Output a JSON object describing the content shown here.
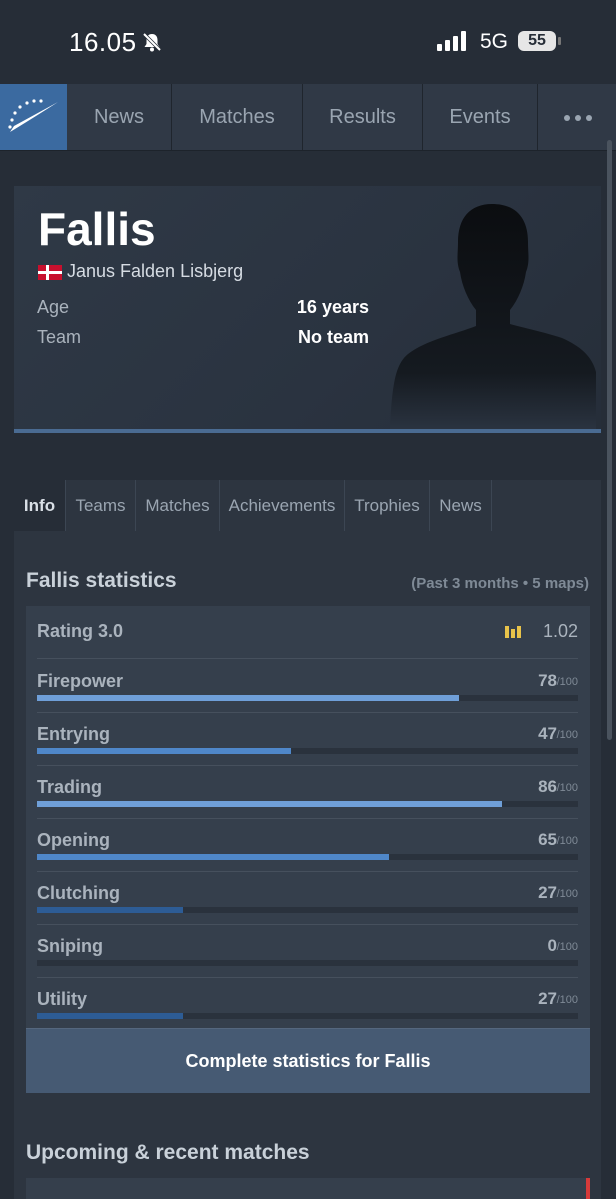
{
  "status_bar": {
    "time": "16.05",
    "network": "5G",
    "battery": "55"
  },
  "nav": {
    "items": [
      "News",
      "Matches",
      "Results",
      "Events"
    ]
  },
  "profile": {
    "nickname": "Fallis",
    "real_name": "Janus Falden Lisbjerg",
    "country_flag": "denmark-flag",
    "age_label": "Age",
    "age_value": "16 years",
    "team_label": "Team",
    "team_value": "No team"
  },
  "tabs": [
    "Info",
    "Teams",
    "Matches",
    "Achievements",
    "Trophies",
    "News"
  ],
  "statistics": {
    "title": "Fallis statistics",
    "subtitle": "(Past 3 months • 5 maps)",
    "rating_label": "Rating 3.0",
    "rating_value": "1.02",
    "max_suffix": "/100",
    "rows": [
      {
        "label": "Firepower",
        "value": "78",
        "percent": 78,
        "color": "#6f9fd8"
      },
      {
        "label": "Entrying",
        "value": "47",
        "percent": 47,
        "color": "#4f87c9"
      },
      {
        "label": "Trading",
        "value": "86",
        "percent": 86,
        "color": "#6f9fd8"
      },
      {
        "label": "Opening",
        "value": "65",
        "percent": 65,
        "color": "#4f87c9"
      },
      {
        "label": "Clutching",
        "value": "27",
        "percent": 27,
        "color": "#2d5c95"
      },
      {
        "label": "Sniping",
        "value": "0",
        "percent": 0,
        "color": "#2d5c95"
      },
      {
        "label": "Utility",
        "value": "27",
        "percent": 27,
        "color": "#2d5c95"
      }
    ],
    "cta_label": "Complete statistics for Fallis"
  },
  "upcoming": {
    "title": "Upcoming & recent matches"
  },
  "colors": {
    "background": "#262d37",
    "accent": "#3b6aa0",
    "rating_icon": "#e8c34a"
  }
}
